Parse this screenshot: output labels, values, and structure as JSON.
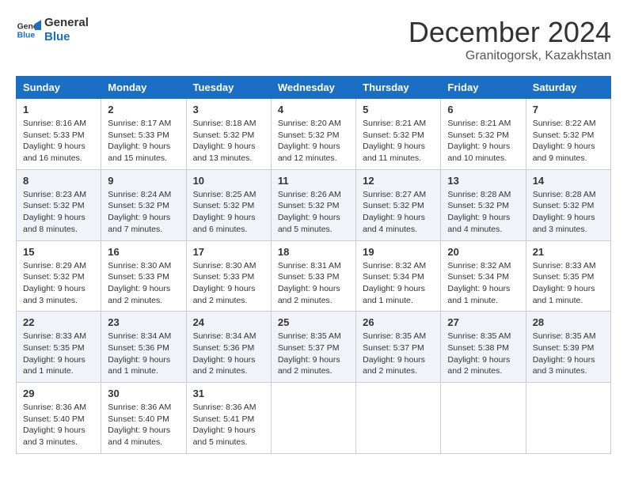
{
  "logo": {
    "line1": "General",
    "line2": "Blue"
  },
  "header": {
    "month": "December 2024",
    "location": "Granitogorsk, Kazakhstan"
  },
  "weekdays": [
    "Sunday",
    "Monday",
    "Tuesday",
    "Wednesday",
    "Thursday",
    "Friday",
    "Saturday"
  ],
  "weeks": [
    [
      {
        "day": "1",
        "sunrise": "8:16 AM",
        "sunset": "5:33 PM",
        "daylight": "9 hours and 16 minutes."
      },
      {
        "day": "2",
        "sunrise": "8:17 AM",
        "sunset": "5:33 PM",
        "daylight": "9 hours and 15 minutes."
      },
      {
        "day": "3",
        "sunrise": "8:18 AM",
        "sunset": "5:32 PM",
        "daylight": "9 hours and 13 minutes."
      },
      {
        "day": "4",
        "sunrise": "8:20 AM",
        "sunset": "5:32 PM",
        "daylight": "9 hours and 12 minutes."
      },
      {
        "day": "5",
        "sunrise": "8:21 AM",
        "sunset": "5:32 PM",
        "daylight": "9 hours and 11 minutes."
      },
      {
        "day": "6",
        "sunrise": "8:21 AM",
        "sunset": "5:32 PM",
        "daylight": "9 hours and 10 minutes."
      },
      {
        "day": "7",
        "sunrise": "8:22 AM",
        "sunset": "5:32 PM",
        "daylight": "9 hours and 9 minutes."
      }
    ],
    [
      {
        "day": "8",
        "sunrise": "8:23 AM",
        "sunset": "5:32 PM",
        "daylight": "9 hours and 8 minutes."
      },
      {
        "day": "9",
        "sunrise": "8:24 AM",
        "sunset": "5:32 PM",
        "daylight": "9 hours and 7 minutes."
      },
      {
        "day": "10",
        "sunrise": "8:25 AM",
        "sunset": "5:32 PM",
        "daylight": "9 hours and 6 minutes."
      },
      {
        "day": "11",
        "sunrise": "8:26 AM",
        "sunset": "5:32 PM",
        "daylight": "9 hours and 5 minutes."
      },
      {
        "day": "12",
        "sunrise": "8:27 AM",
        "sunset": "5:32 PM",
        "daylight": "9 hours and 4 minutes."
      },
      {
        "day": "13",
        "sunrise": "8:28 AM",
        "sunset": "5:32 PM",
        "daylight": "9 hours and 4 minutes."
      },
      {
        "day": "14",
        "sunrise": "8:28 AM",
        "sunset": "5:32 PM",
        "daylight": "9 hours and 3 minutes."
      }
    ],
    [
      {
        "day": "15",
        "sunrise": "8:29 AM",
        "sunset": "5:32 PM",
        "daylight": "9 hours and 3 minutes."
      },
      {
        "day": "16",
        "sunrise": "8:30 AM",
        "sunset": "5:33 PM",
        "daylight": "9 hours and 2 minutes."
      },
      {
        "day": "17",
        "sunrise": "8:30 AM",
        "sunset": "5:33 PM",
        "daylight": "9 hours and 2 minutes."
      },
      {
        "day": "18",
        "sunrise": "8:31 AM",
        "sunset": "5:33 PM",
        "daylight": "9 hours and 2 minutes."
      },
      {
        "day": "19",
        "sunrise": "8:32 AM",
        "sunset": "5:34 PM",
        "daylight": "9 hours and 1 minute."
      },
      {
        "day": "20",
        "sunrise": "8:32 AM",
        "sunset": "5:34 PM",
        "daylight": "9 hours and 1 minute."
      },
      {
        "day": "21",
        "sunrise": "8:33 AM",
        "sunset": "5:35 PM",
        "daylight": "9 hours and 1 minute."
      }
    ],
    [
      {
        "day": "22",
        "sunrise": "8:33 AM",
        "sunset": "5:35 PM",
        "daylight": "9 hours and 1 minute."
      },
      {
        "day": "23",
        "sunrise": "8:34 AM",
        "sunset": "5:36 PM",
        "daylight": "9 hours and 1 minute."
      },
      {
        "day": "24",
        "sunrise": "8:34 AM",
        "sunset": "5:36 PM",
        "daylight": "9 hours and 2 minutes."
      },
      {
        "day": "25",
        "sunrise": "8:35 AM",
        "sunset": "5:37 PM",
        "daylight": "9 hours and 2 minutes."
      },
      {
        "day": "26",
        "sunrise": "8:35 AM",
        "sunset": "5:37 PM",
        "daylight": "9 hours and 2 minutes."
      },
      {
        "day": "27",
        "sunrise": "8:35 AM",
        "sunset": "5:38 PM",
        "daylight": "9 hours and 2 minutes."
      },
      {
        "day": "28",
        "sunrise": "8:35 AM",
        "sunset": "5:39 PM",
        "daylight": "9 hours and 3 minutes."
      }
    ],
    [
      {
        "day": "29",
        "sunrise": "8:36 AM",
        "sunset": "5:40 PM",
        "daylight": "9 hours and 3 minutes."
      },
      {
        "day": "30",
        "sunrise": "8:36 AM",
        "sunset": "5:40 PM",
        "daylight": "9 hours and 4 minutes."
      },
      {
        "day": "31",
        "sunrise": "8:36 AM",
        "sunset": "5:41 PM",
        "daylight": "9 hours and 5 minutes."
      },
      null,
      null,
      null,
      null
    ]
  ]
}
